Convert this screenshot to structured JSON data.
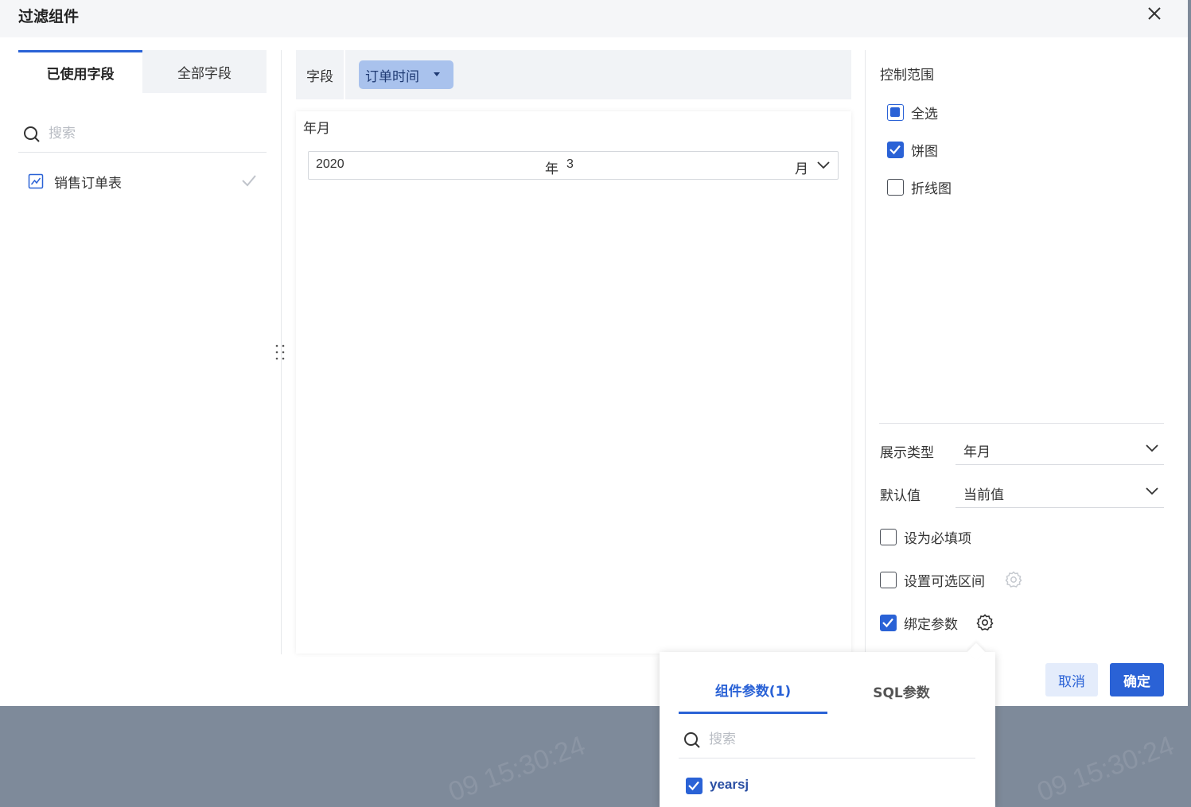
{
  "dialog": {
    "title": "过滤组件"
  },
  "left_panel": {
    "tabs": [
      {
        "label": "已使用字段"
      },
      {
        "label": "全部字段"
      }
    ],
    "search_placeholder": "搜索",
    "items": [
      {
        "label": "销售订单表"
      }
    ]
  },
  "middle": {
    "field_label": "字段",
    "field_chip": "订单时间",
    "preview_title": "年月",
    "date_picker": {
      "year": "2020",
      "year_unit": "年",
      "month": "3",
      "month_unit": "月"
    }
  },
  "right_panel": {
    "control_range_title": "控制范围",
    "range_options": [
      {
        "label": "全选",
        "state": "partial"
      },
      {
        "label": "饼图",
        "state": "checked"
      },
      {
        "label": "折线图",
        "state": "unchecked"
      }
    ],
    "display_type": {
      "label": "展示类型",
      "value": "年月"
    },
    "default_value": {
      "label": "默认值",
      "value": "当前值"
    },
    "options": [
      {
        "label": "设为必填项",
        "checked": false
      },
      {
        "label": "设置可选区间",
        "checked": false
      },
      {
        "label": "绑定参数",
        "checked": true
      }
    ]
  },
  "buttons": {
    "cancel": "取消",
    "ok": "确定"
  },
  "popover": {
    "tabs": [
      {
        "label": "组件参数(1)"
      },
      {
        "label": "SQL参数"
      }
    ],
    "search_placeholder": "搜索",
    "items": [
      {
        "label": "yearsj",
        "checked": true
      }
    ]
  },
  "background": {
    "watermark": "09 15:30:24"
  },
  "colors": {
    "accent": "#2a62d6",
    "chip": "#a9c2ed",
    "backdrop": "#7e8a9a"
  }
}
